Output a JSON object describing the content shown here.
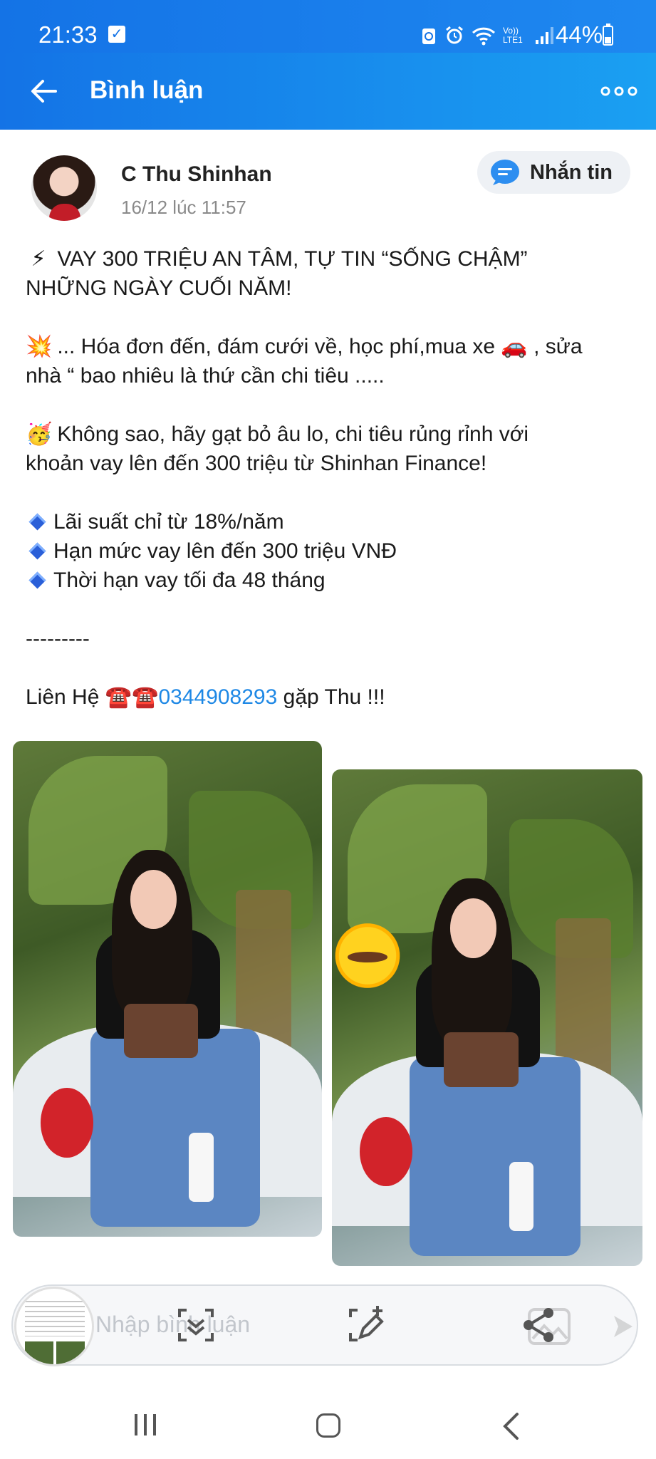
{
  "status_bar": {
    "time": "21:33",
    "battery_text": "44%",
    "battery_level": 0.44,
    "icons": [
      "checklist-icon",
      "recycle-icon",
      "alarm-icon",
      "wifi-icon",
      "volte-lte-icon",
      "signal-icon",
      "battery-icon"
    ],
    "network_label": "Vo)) LTE1"
  },
  "header": {
    "title": "Bình luận",
    "gradient_start": "#1473e6",
    "gradient_end": "#1aa0f2"
  },
  "post": {
    "author": "C Thu Shinhan",
    "timestamp": "16/12 lúc 11:57",
    "message_button": "Nhắn tin",
    "lines": [
      {
        "emoji": "⚡",
        "text": "VAY 300 TRIỆU AN TÂM, TỰ TIN “SỐNG CHẬM”"
      },
      {
        "emoji": "",
        "text": "NHỮNG NGÀY CUỐI NĂM!"
      },
      {
        "emoji": "💥",
        "text": "... Hóa đơn đến, đám cưới về, học phí,mua xe 🚗 , sửa"
      },
      {
        "emoji": "",
        "text": "nhà “ bao nhiêu là thứ cần chi tiêu ....."
      },
      {
        "emoji": "🥳",
        "text": "Không sao, hãy gạt bỏ âu lo, chi tiêu rủng rỉnh với"
      },
      {
        "emoji": "",
        "text": "khoản vay lên đến 300 triệu từ Shinhan Finance!"
      }
    ],
    "bullets": [
      "Lãi suất chỉ từ 18%/năm",
      "Hạn mức vay lên đến 300 triệu VNĐ",
      "Thời hạn vay tối đa 48 tháng"
    ],
    "divider": "---------",
    "contact_prefix": "Liên Hệ ☎️☎️",
    "phone": "0344908293",
    "contact_suffix": " gặp Thu !!!",
    "link_color": "#1e88e5"
  },
  "comment_bar": {
    "placeholder": "Nhập bình luận",
    "tools": [
      "scan-icon",
      "edit-capture-icon",
      "share-icon"
    ]
  },
  "nav_bar": {
    "buttons": [
      "recent-apps-icon",
      "home-icon",
      "back-icon"
    ]
  }
}
